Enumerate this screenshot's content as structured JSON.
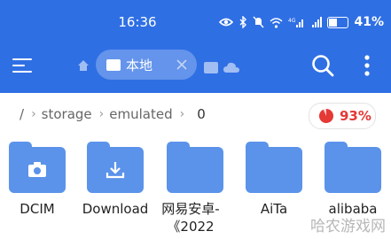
{
  "status": {
    "time": "16:36",
    "network_label": "4G",
    "battery": "41%"
  },
  "toolbar": {
    "tab_label": "本地"
  },
  "breadcrumb": {
    "root": "/",
    "items": [
      "storage",
      "emulated",
      "0"
    ]
  },
  "storage": {
    "percent_label": "93%",
    "used_fraction": 0.93,
    "color": "#e53935"
  },
  "folders": [
    {
      "name": "DCIM",
      "icon": "camera-icon"
    },
    {
      "name": "Download",
      "icon": "download-icon"
    },
    {
      "name": "网易安卓-《2022",
      "icon": "folder-icon"
    },
    {
      "name": "AiTa",
      "icon": "folder-icon"
    },
    {
      "name": "alibaba",
      "icon": "folder-icon"
    }
  ],
  "watermark": "哈农游戏网",
  "colors": {
    "accent": "#2f6fe4",
    "folder": "#5b93ea"
  }
}
